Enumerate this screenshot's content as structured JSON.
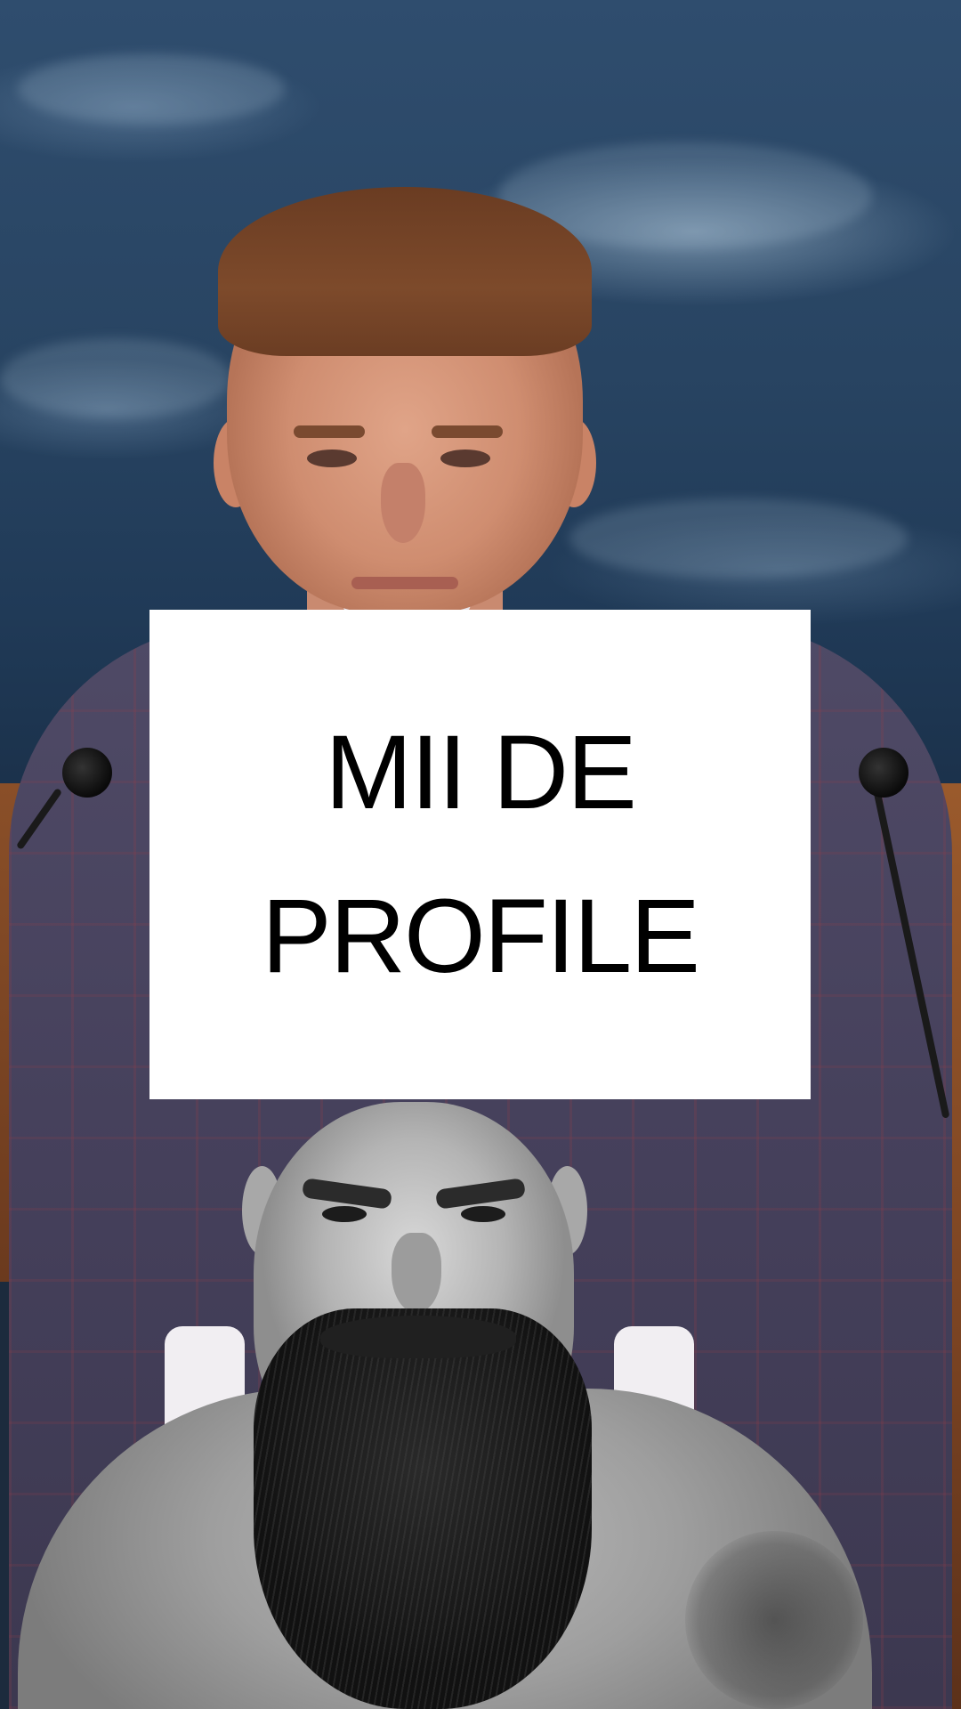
{
  "caption": {
    "text": "MII DE\nPROFILE"
  },
  "colors": {
    "background_wall": "#2f4d6e",
    "caption_background": "#ffffff",
    "caption_text": "#000000"
  }
}
